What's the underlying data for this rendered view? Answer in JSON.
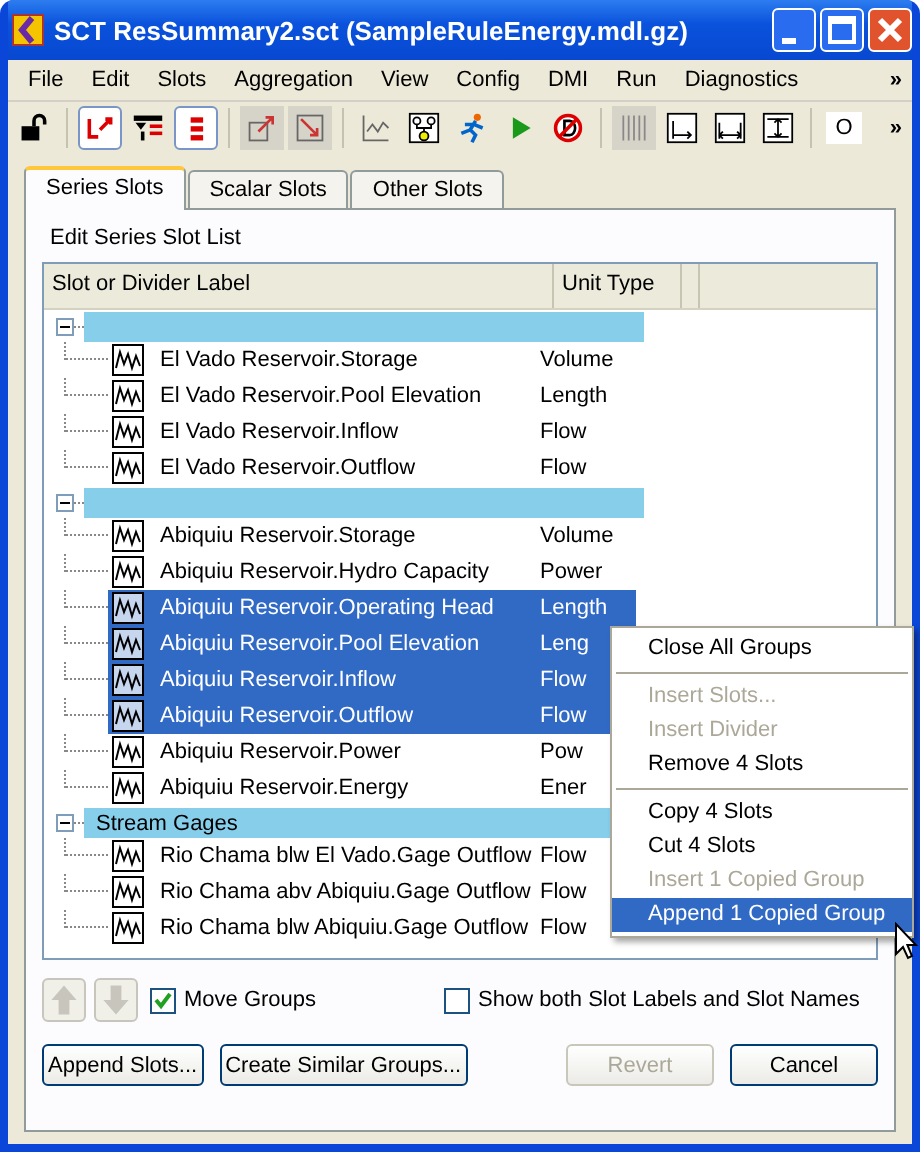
{
  "window": {
    "title": "SCT ResSummary2.sct (SampleRuleEnergy.mdl.gz)"
  },
  "menu": [
    "File",
    "Edit",
    "Slots",
    "Aggregation",
    "View",
    "Config",
    "DMI",
    "Run",
    "Diagnostics"
  ],
  "menu_more": "»",
  "toolbar": [
    {
      "kind": "lock",
      "pressed": false,
      "disabled": false
    },
    {
      "kind": "sep"
    },
    {
      "kind": "link",
      "pressed": true,
      "disabled": false
    },
    {
      "kind": "filter",
      "pressed": false,
      "disabled": false
    },
    {
      "kind": "list",
      "pressed": true,
      "disabled": false
    },
    {
      "kind": "sep"
    },
    {
      "kind": "export",
      "pressed": false,
      "disabled": true
    },
    {
      "kind": "import",
      "pressed": false,
      "disabled": true
    },
    {
      "kind": "sep"
    },
    {
      "kind": "plot",
      "pressed": false,
      "disabled": false
    },
    {
      "kind": "tree",
      "pressed": false,
      "disabled": false
    },
    {
      "kind": "runner",
      "pressed": false,
      "disabled": false
    },
    {
      "kind": "play",
      "pressed": false,
      "disabled": false
    },
    {
      "kind": "stop",
      "pressed": false,
      "disabled": false
    },
    {
      "kind": "sep"
    },
    {
      "kind": "columns",
      "pressed": false,
      "disabled": true
    },
    {
      "kind": "fitleft",
      "pressed": false,
      "disabled": false
    },
    {
      "kind": "fitboth",
      "pressed": false,
      "disabled": false
    },
    {
      "kind": "fitall",
      "pressed": false,
      "disabled": false
    },
    {
      "kind": "sep"
    },
    {
      "kind": "text",
      "label": "O",
      "pressed": false,
      "disabled": false
    }
  ],
  "toolbar_more": "»",
  "tabs": [
    {
      "label": "Series Slots",
      "selected": true
    },
    {
      "label": "Scalar Slots",
      "selected": false
    },
    {
      "label": "Other Slots",
      "selected": false
    }
  ],
  "section_label": "Edit Series Slot List",
  "table": {
    "columns": [
      "Slot or Divider Label",
      "Unit Type"
    ],
    "groups": [
      {
        "expanded": true,
        "slots": [
          {
            "name": "El Vado Reservoir.Storage",
            "unit": "Volume",
            "selected": false
          },
          {
            "name": "El Vado Reservoir.Pool Elevation",
            "unit": "Length",
            "selected": false
          },
          {
            "name": "El Vado Reservoir.Inflow",
            "unit": "Flow",
            "selected": false
          },
          {
            "name": "El Vado Reservoir.Outflow",
            "unit": "Flow",
            "selected": false
          }
        ]
      },
      {
        "expanded": true,
        "slots": [
          {
            "name": "Abiquiu Reservoir.Storage",
            "unit": "Volume",
            "selected": false
          },
          {
            "name": "Abiquiu Reservoir.Hydro Capacity",
            "unit": "Power",
            "selected": false
          },
          {
            "name": "Abiquiu Reservoir.Operating Head",
            "unit": "Length",
            "selected": true
          },
          {
            "name": "Abiquiu Reservoir.Pool Elevation",
            "unit": "Leng",
            "selected": true
          },
          {
            "name": "Abiquiu Reservoir.Inflow",
            "unit": "Flow",
            "selected": true
          },
          {
            "name": "Abiquiu Reservoir.Outflow",
            "unit": "Flow",
            "selected": true
          },
          {
            "name": "Abiquiu Reservoir.Power",
            "unit": "Pow",
            "selected": false
          },
          {
            "name": "Abiquiu Reservoir.Energy",
            "unit": "Ener",
            "selected": false
          }
        ]
      },
      {
        "label": "Stream Gages",
        "expanded": true,
        "slots": [
          {
            "name": "Rio Chama blw El Vado.Gage Outflow",
            "unit": "Flow",
            "selected": false
          },
          {
            "name": "Rio Chama abv Abiquiu.Gage Outflow",
            "unit": "Flow",
            "selected": false
          },
          {
            "name": "Rio Chama blw Abiquiu.Gage Outflow",
            "unit": "Flow",
            "selected": false
          }
        ]
      }
    ]
  },
  "move_up": {
    "disabled": true
  },
  "move_down": {
    "disabled": true
  },
  "move_groups": {
    "label": "Move Groups",
    "checked": true
  },
  "show_both": {
    "label": "Show both Slot Labels and Slot Names",
    "checked": false
  },
  "buttons": [
    {
      "label": "Append Slots...",
      "disabled": false
    },
    {
      "label": "Create Similar Groups...",
      "disabled": false
    },
    {
      "label": "Revert",
      "disabled": true
    },
    {
      "label": "Cancel",
      "disabled": false
    }
  ],
  "context_menu": [
    {
      "kind": "item",
      "label": "Close All Groups",
      "disabled": false,
      "selected": false
    },
    {
      "kind": "separator"
    },
    {
      "kind": "item",
      "label": "Insert Slots...",
      "disabled": true,
      "selected": false
    },
    {
      "kind": "item",
      "label": "Insert Divider",
      "disabled": true,
      "selected": false
    },
    {
      "kind": "item",
      "label": "Remove 4 Slots",
      "disabled": false,
      "selected": false
    },
    {
      "kind": "separator"
    },
    {
      "kind": "item",
      "label": "Copy 4 Slots",
      "disabled": false,
      "selected": false
    },
    {
      "kind": "item",
      "label": "Cut 4 Slots",
      "disabled": false,
      "selected": false
    },
    {
      "kind": "item",
      "label": "Insert 1 Copied Group",
      "disabled": true,
      "selected": false
    },
    {
      "kind": "item",
      "label": "Append 1 Copied Group",
      "disabled": false,
      "selected": true
    }
  ]
}
